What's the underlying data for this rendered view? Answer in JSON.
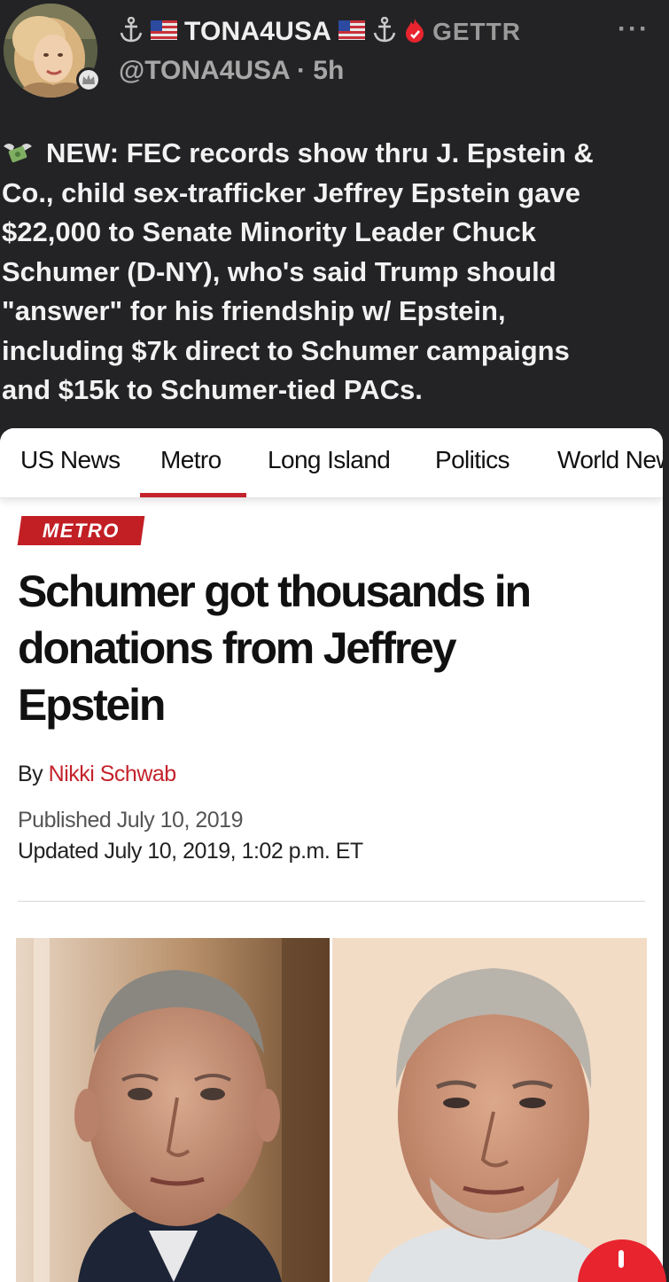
{
  "post": {
    "display_name": "TONA4USA",
    "platform_label": "GETTR",
    "handle_time": "@TONA4USA · 5h",
    "more_label": "···",
    "text_lines": [
      "NEW: FEC records show thru J. Epstein &",
      "Co., child sex-trafficker Jeffrey Epstein gave",
      "$22,000 to Senate Minority Leader Chuck",
      "Schumer (D-NY), who's said Trump should",
      "\"answer\" for his friendship w/ Epstein,",
      "including $7k direct to Schumer campaigns",
      "and $15k to Schumer-tied PACs."
    ],
    "leading_icon": "money-with-wings-icon"
  },
  "article": {
    "nav": [
      "US News",
      "Metro",
      "Long Island",
      "Politics",
      "World News"
    ],
    "active_nav": "Metro",
    "section_tag": "METRO",
    "headline_lines": [
      "Schumer got thousands in",
      "donations from Jeffrey",
      "Epstein"
    ],
    "byline_prefix": "By",
    "author": "Nikki Schwab",
    "published": "Published July 10, 2019",
    "updated": "Updated July 10, 2019, 1:02 p.m. ET"
  },
  "colors": {
    "app_background": "#232325",
    "accent_red": "#c4232c",
    "gettr_flame": "#e8242f"
  }
}
